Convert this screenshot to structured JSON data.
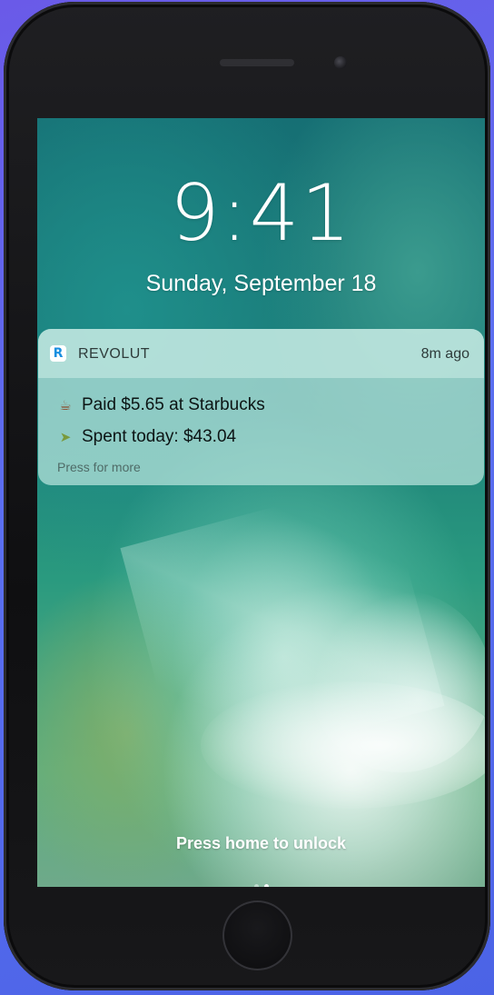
{
  "lock_screen": {
    "time": "9:41",
    "date": "Sunday, September 18",
    "unlock_hint": "Press home to unlock"
  },
  "notification": {
    "app_icon_letter": "R",
    "app_name": "REVOLUT",
    "time_ago": "8m ago",
    "lines": [
      {
        "icon": "coffee-cup-icon",
        "text": "Paid $5.65 at Starbucks"
      },
      {
        "icon": "money-wings-icon",
        "text": "Spent today: $43.04"
      }
    ],
    "footer": "Press for more"
  },
  "colors": {
    "background": "#5b6ff0",
    "app_icon_accent": "#1a8fe0"
  }
}
